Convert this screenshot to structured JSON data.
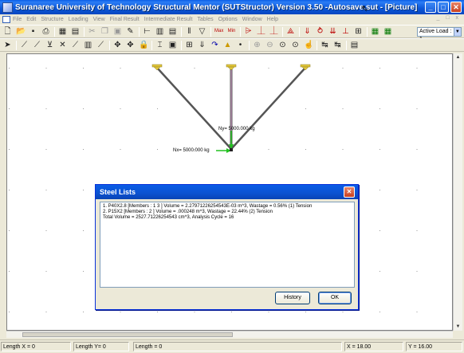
{
  "window": {
    "title": "Suranaree University of Technology Structural Mentor (SUTStructor) Version 3.50 -Autosave.sut - [Picture]",
    "min_label": "_",
    "max_label": "□",
    "close_label": "✕"
  },
  "menu": {
    "items": [
      "File",
      "Edit",
      "Structure",
      "Loading",
      "View",
      "Final Result",
      "Intermediate Result",
      "Tables",
      "Options",
      "Window",
      "Help"
    ],
    "mdi_controls": "_ □ x"
  },
  "toolbar": {
    "load_case": "Active Load : 1",
    "row1_icons": [
      "new-file-icon",
      "open-folder-icon",
      "save-icon",
      "print-icon",
      "print-preview-icon",
      "export-icon",
      "cut-icon",
      "copy-icon",
      "paste-icon",
      "pen-icon",
      "line-icon",
      "rectangle-icon",
      "grid-icon",
      "column-icon",
      "filter-icon",
      "max-icon",
      "min-icon",
      "member-icon",
      "support-icon",
      "support2-icon",
      "truss-icon",
      "load-icon",
      "moment-icon",
      "load2-icon",
      "beam-icon",
      "frame-icon",
      "table-icon",
      "table2-icon"
    ],
    "row2_icons": [
      "pointer-icon",
      "add-node-icon",
      "add-member-icon",
      "add-support-icon",
      "delete-icon",
      "draw-icon",
      "hatch-icon",
      "text-icon",
      "move-icon",
      "copy-node-icon",
      "lock-icon",
      "dimension-icon",
      "section-icon",
      "mesh-icon",
      "load-arrow-icon",
      "release-icon",
      "color-icon",
      "line-style-icon",
      "zoom-in-icon",
      "zoom-out-icon",
      "zoom-window-icon",
      "zoom-all-icon",
      "pan-icon",
      "snap-icon",
      "snap2-icon",
      "settings-icon"
    ]
  },
  "drawing": {
    "load_y_label": "Ny= 5000.000 kg",
    "load_x_label": "Nx= 5000.000 kg",
    "colors": {
      "member": "#555555",
      "support": "#e3c73a",
      "load_x": "#21c11f",
      "load_y": "#21c11f"
    }
  },
  "dialog": {
    "title": "Steel Lists",
    "lines": [
      "1. P40X2.8  [Members : 1 3 ] Volume = 2.27971226254543E-03 m^3, Wastage = 0.56% (1) Tension",
      "2. P15X2  [Members : 2 ] Volume = .000248 m^3, Wastage = 22.44% (2) Tension",
      "Total Volume = 2527.71226254543 cm^3, Analysis Cycle = 16"
    ],
    "history_label": "History",
    "ok_label": "OK",
    "close_label": "✕"
  },
  "status": {
    "length_x": "Length X = 0",
    "length_y": "Length Y= 0",
    "length": "Length = 0",
    "x": "X = 18.00",
    "y": "Y = 16.00"
  }
}
